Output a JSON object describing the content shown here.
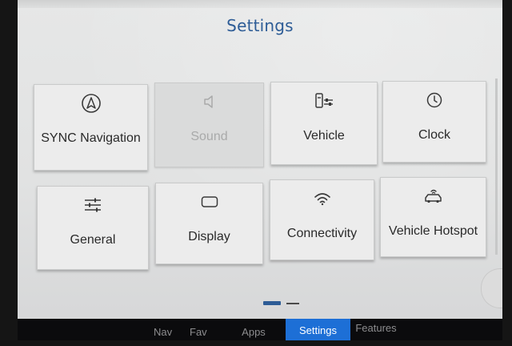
{
  "page": {
    "title": "Settings"
  },
  "tiles": [
    {
      "label": "SYNC Navigation",
      "icon": "navigation-arrow-icon",
      "enabled": true
    },
    {
      "label": "Sound",
      "icon": "speaker-icon",
      "enabled": false
    },
    {
      "label": "Vehicle",
      "icon": "vehicle-settings-icon",
      "enabled": true
    },
    {
      "label": "Clock",
      "icon": "clock-icon",
      "enabled": true
    },
    {
      "label": "General",
      "icon": "sliders-icon",
      "enabled": true
    },
    {
      "label": "Display",
      "icon": "display-icon",
      "enabled": true
    },
    {
      "label": "Connectivity",
      "icon": "wifi-icon",
      "enabled": true
    },
    {
      "label": "Vehicle Hotspot",
      "icon": "car-hotspot-icon",
      "enabled": true
    }
  ],
  "pager": {
    "current": 1,
    "total": 2
  },
  "navbar": {
    "items": [
      {
        "label": "Nav"
      },
      {
        "label": "Fav"
      },
      {
        "label": "Apps"
      },
      {
        "label": "Settings",
        "active": true
      },
      {
        "label": "Features"
      }
    ]
  },
  "colors": {
    "accent": "#2d5c96",
    "active_tab": "#1d6fd6",
    "tile_bg": "#ececec",
    "screen_bg": "#e1e2e2"
  }
}
